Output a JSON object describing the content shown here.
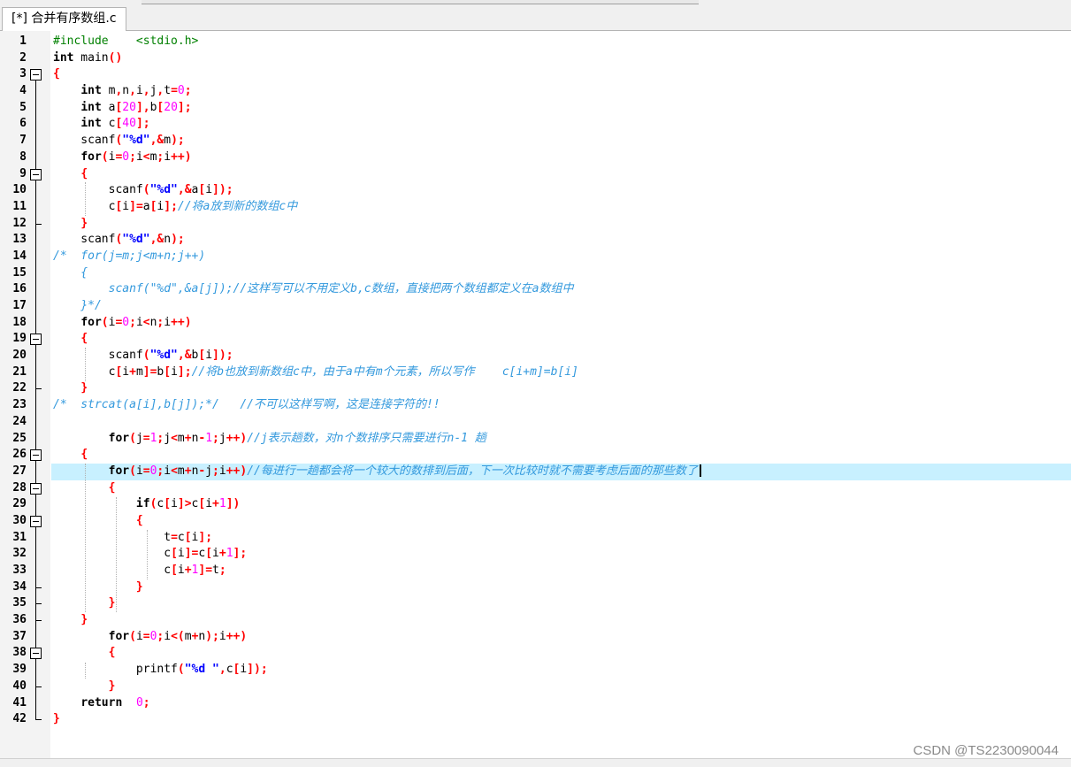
{
  "tab": {
    "title": "[*] 合并有序数组.c"
  },
  "colors": {
    "keyword": "#000000",
    "preprocessor": "#008000",
    "number": "#ff00ff",
    "operator": "#ff0000",
    "string": "#0000ff",
    "comment": "#3399dd",
    "highlight_line": "#c8f0ff"
  },
  "editor": {
    "highlighted_line": 27,
    "lines": [
      "#include    <stdio.h>",
      "int main()",
      "{",
      "    int m,n,i,j,t=0;",
      "    int a[20],b[20];",
      "    int c[40];",
      "    scanf(\"%d\",&m);",
      "    for(i=0;i<m;i++)",
      "    {",
      "        scanf(\"%d\",&a[i]);",
      "        c[i]=a[i];//将a放到新的数组c中",
      "    }",
      "    scanf(\"%d\",&n);",
      "/*  for(j=m;j<m+n;j++)",
      "    {",
      "        scanf(\"%d\",&a[j]);//这样写可以不用定义b,c数组，直接把两个数组都定义在a数组中",
      "    }*/",
      "    for(i=0;i<n;i++)",
      "    {",
      "        scanf(\"%d\",&b[i]);",
      "        c[i+m]=b[i];//将b也放到新数组c中，由于a中有m个元素，所以写作    c[i+m]=b[i]",
      "    }",
      "/*  strcat(a[i],b[j]);*/   //不可以这样写啊，这是连接字符的!!",
      "",
      "        for(j=1;j<m+n-1;j++)//j表示趟数，对n个数排序只需要进行n-1 趟",
      "    {",
      "        for(i=0;i<m+n-j;i++)//每进行一趟都会将一个较大的数排到后面，下一次比较时就不需要考虑后面的那些数了",
      "        {",
      "            if(c[i]>c[i+1])",
      "            {",
      "                t=c[i];",
      "                c[i]=c[i+1];",
      "                c[i+1]=t;",
      "            }",
      "        }",
      "    }",
      "        for(i=0;i<(m+n);i++)",
      "        {",
      "            printf(\"%d \",c[i]);",
      "        }",
      "    return  0;",
      "}"
    ]
  },
  "watermark": "CSDN @TS2230090044"
}
